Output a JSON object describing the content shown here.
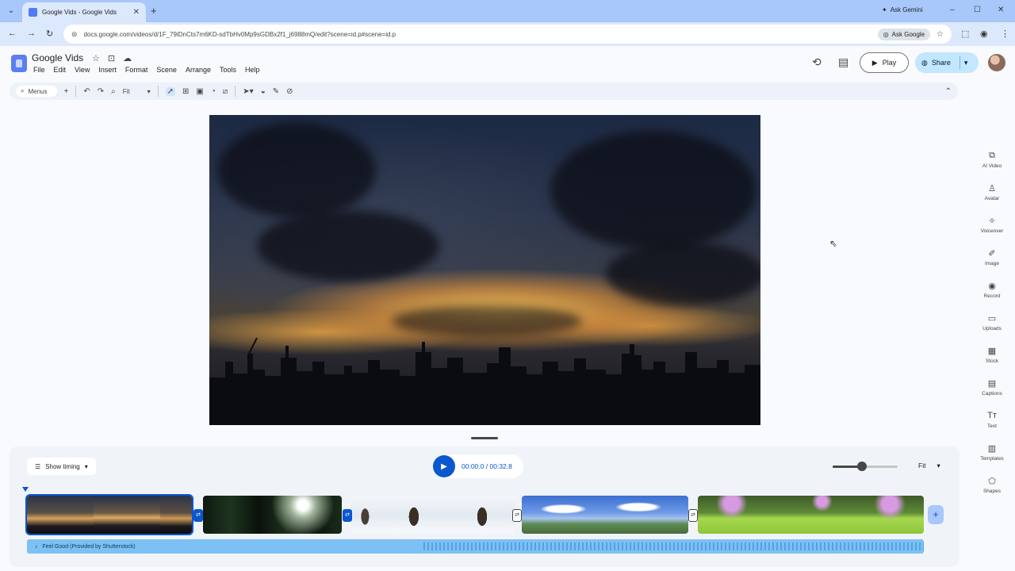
{
  "browser": {
    "tab_title": "Google Vids - Google Vids",
    "new_tab": "+",
    "ask_gemini": "Ask Gemini",
    "url": "docs.google.com/videos/d/1F_79iDnCts7m6KD-sdTbHv0Mp9sGDBx2f1_j6988mQ/edit?scene=id.p#scene=id.p",
    "ask_google": "Ask Google",
    "controls": {
      "minimize": "–",
      "maximize": "☐",
      "close": "✕"
    }
  },
  "app": {
    "doc_title": "Google Vids",
    "menu": [
      "File",
      "Edit",
      "View",
      "Insert",
      "Format",
      "Scene",
      "Arrange",
      "Tools",
      "Help"
    ],
    "play_label": "Play",
    "share_label": "Share"
  },
  "toolbar": {
    "search_label": "Menus",
    "zoom_label": "Fit"
  },
  "side_panel": [
    {
      "label": "AI Video",
      "icon": "ai-video-icon"
    },
    {
      "label": "Avatar",
      "icon": "avatar-icon"
    },
    {
      "label": "Voiceover",
      "icon": "voiceover-icon"
    },
    {
      "label": "Image",
      "icon": "image-icon"
    },
    {
      "label": "Record",
      "icon": "record-icon"
    },
    {
      "label": "Uploads",
      "icon": "uploads-icon"
    },
    {
      "label": "Stock",
      "icon": "stock-icon"
    },
    {
      "label": "Captions",
      "icon": "captions-icon"
    },
    {
      "label": "Text",
      "icon": "text-icon"
    },
    {
      "label": "Templates",
      "icon": "templates-icon"
    },
    {
      "label": "Shapes",
      "icon": "shapes-icon"
    }
  ],
  "timeline": {
    "show_timing_label": "Show timing",
    "time_current": "00:00.0",
    "time_total": "00:32.8",
    "time_separator": "/",
    "zoom_label": "Fit",
    "zoom_level": 0.45,
    "audio_label": "Feel Good (Provided by Shutterstock)",
    "clips": [
      {
        "name": "sunset-skyline",
        "selected": true
      },
      {
        "name": "forest-sun"
      },
      {
        "name": "snowy-trees"
      },
      {
        "name": "blue-sky-field"
      },
      {
        "name": "flower-meadow"
      }
    ]
  }
}
